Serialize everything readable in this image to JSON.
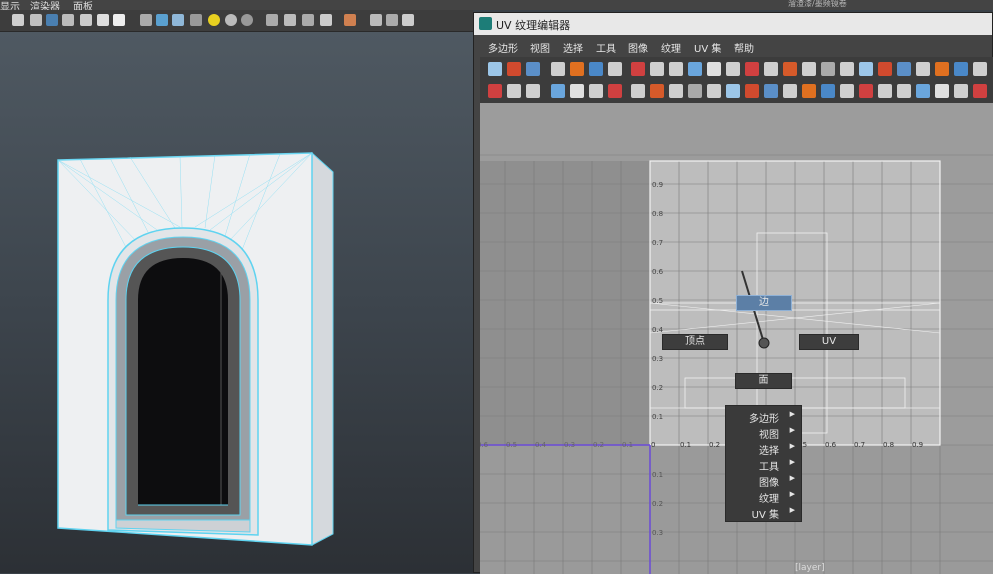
{
  "main_menu": {
    "items": [
      "显示",
      "渲染器",
      "面板"
    ]
  },
  "uv_window": {
    "title": "UV 纹理编辑器",
    "menu": [
      "多边形",
      "视图",
      "选择",
      "工具",
      "图像",
      "纹理",
      "UV 集",
      "帮助"
    ]
  },
  "axis": {
    "y_ticks": [
      "0.9",
      "0.8",
      "0.7",
      "0.6",
      "0.5",
      "0.4",
      "0.3",
      "0.2",
      "0.1"
    ],
    "x_ticks": [
      "0",
      "0.1",
      "0.2",
      "0.3",
      "0.4",
      "0.5",
      "0.6",
      "0.7",
      "0.8",
      "0.9"
    ],
    "neg_x_ticks": [
      "0.6",
      "0.5",
      "0.4",
      "0.3",
      "0.2",
      "0.1"
    ],
    "neg_y_ticks": [
      "0.1",
      "0.2",
      "0.3"
    ]
  },
  "marking_menu": {
    "north": "边",
    "west": "顶点",
    "east": "UV",
    "south": "面",
    "sub_items": [
      "多边形",
      "视图",
      "选择",
      "工具",
      "图像",
      "纹理",
      "UV 集"
    ]
  },
  "bottom_hint": "[layer]",
  "top_right_hint": "溜渣漆/墨频镜卷"
}
